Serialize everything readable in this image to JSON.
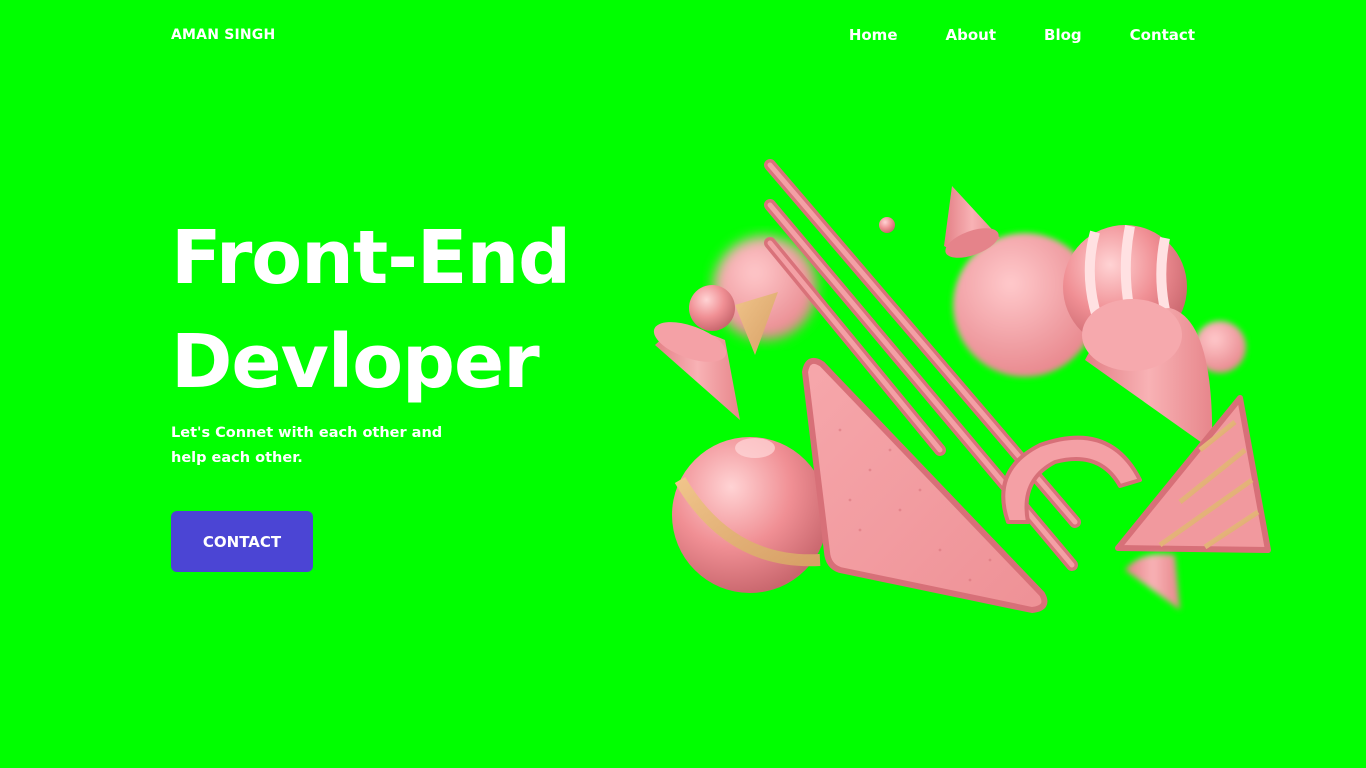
{
  "header": {
    "logo": "AMAN SINGH",
    "nav": [
      "Home",
      "About",
      "Blog",
      "Contact"
    ]
  },
  "hero": {
    "title_line1": "Front-End",
    "title_line2": "Devloper",
    "subtitle_line1": "Let's Connet with each other and",
    "subtitle_line2": "help each other.",
    "cta_label": "CONTACT"
  },
  "colors": {
    "background": "#00ff00",
    "text": "#ffffff",
    "cta_background": "#4b45d4",
    "shape_pink": "#f29a9e"
  }
}
